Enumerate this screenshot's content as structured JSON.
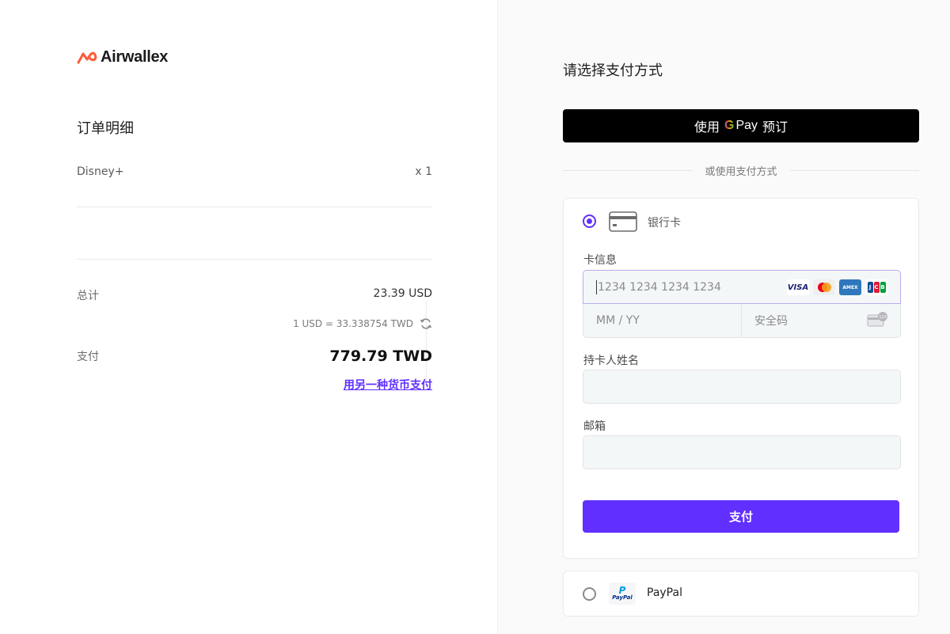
{
  "brand": {
    "name": "Airwallex",
    "accent": "#612fff",
    "logo_color": "#ff5b38"
  },
  "order": {
    "title": "订单明细",
    "items": [
      {
        "name": "Disney+",
        "qty": "x 1"
      }
    ],
    "total_label": "总计",
    "total_value": "23.39 USD",
    "exchange_rate": "1 USD = 33.338754 TWD",
    "pay_label": "支付",
    "pay_value": "779.79 TWD",
    "alt_currency_link": "用另一种货币支付"
  },
  "payment": {
    "title": "请选择支付方式",
    "gpay": {
      "prefix": "使用",
      "g": "G",
      "pay": "Pay",
      "suffix": "预订"
    },
    "or_text": "或使用支付方式",
    "card": {
      "method_label": "银行卡",
      "selected": true,
      "card_info_label": "卡信息",
      "number_placeholder": "1234 1234 1234 1234",
      "expiry_placeholder": "MM / YY",
      "cvc_placeholder": "安全码",
      "brands": [
        "VISA",
        "Mastercard",
        "American Express",
        "JCB"
      ],
      "holder_label": "持卡人姓名",
      "holder_value": "",
      "email_label": "邮箱",
      "email_value": "",
      "submit_label": "支付"
    },
    "paypal": {
      "label": "PayPal",
      "selected": false
    }
  }
}
